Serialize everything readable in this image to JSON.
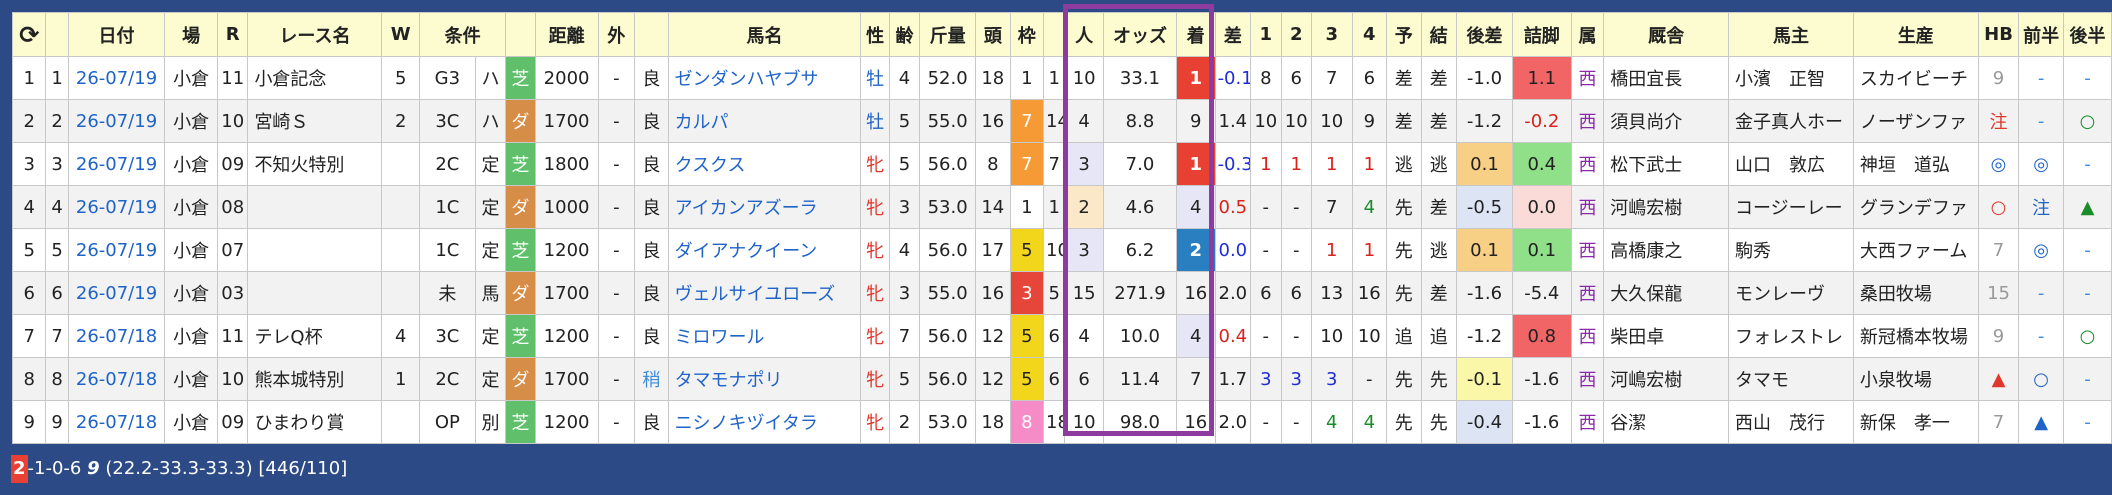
{
  "header": {
    "refresh_icon": "⟳",
    "date": "日付",
    "venue": "場",
    "race_no": "R",
    "race_name": "レース名",
    "w": "W",
    "condition": "条件",
    "distance": "距離",
    "outside": "外",
    "horse": "馬名",
    "sex": "性",
    "age": "齢",
    "weight": "斤量",
    "heads": "頭",
    "waku": "枠",
    "popularity": "人",
    "odds": "オッズ",
    "finish": "着",
    "margin": "差",
    "c1": "1",
    "c2": "2",
    "c3": "3",
    "c4": "4",
    "pred": "予",
    "result": "結",
    "late3f": "後差",
    "closing": "詰脚",
    "belong": "属",
    "stable": "厩舎",
    "owner": "馬主",
    "breeder": "生産",
    "hb": "HB",
    "first_half": "前半",
    "second_half": "後半"
  },
  "rows": [
    {
      "idx": "1",
      "no": "1",
      "date": "26-07/19",
      "venue": "小倉",
      "r": "11",
      "race": "小倉記念",
      "w": "5",
      "cls": "G3",
      "mark": "ハ",
      "surf": "芝",
      "surf_type": "turf",
      "dist": "2000",
      "out": "-",
      "cond": "良",
      "horse": "ゼンダンハヤブサ",
      "sex": "牡",
      "sex_type": "m",
      "age": "4",
      "kg": "52.0",
      "heads": "18",
      "waku": "1",
      "umaban": "1",
      "pop": "10",
      "odds": "33.1",
      "fin": "1",
      "margin": "-0.1",
      "c1": "8",
      "c2": "6",
      "c3": "7",
      "c4": "6",
      "pred": "差",
      "res": "差",
      "late": "-1.0",
      "close": "1.1",
      "belong": "西",
      "stable": "橋田宜長",
      "owner": "小濱　正智",
      "breeder": "スカイビーチ",
      "hb": "9",
      "fh": "-",
      "sh": "-"
    },
    {
      "idx": "2",
      "no": "2",
      "date": "26-07/19",
      "venue": "小倉",
      "r": "10",
      "race": "宮崎Ｓ",
      "w": "2",
      "cls": "3C",
      "mark": "ハ",
      "surf": "ダ",
      "surf_type": "dirt",
      "dist": "1700",
      "out": "-",
      "cond": "良",
      "horse": "カルパ",
      "sex": "牡",
      "sex_type": "m",
      "age": "5",
      "kg": "55.0",
      "heads": "16",
      "waku": "7",
      "umaban": "14",
      "pop": "4",
      "odds": "8.8",
      "fin": "9",
      "margin": "1.4",
      "c1": "10",
      "c2": "10",
      "c3": "10",
      "c4": "9",
      "pred": "差",
      "res": "差",
      "late": "-1.2",
      "close": "-0.2",
      "belong": "西",
      "stable": "須貝尚介",
      "owner": "金子真人ホー",
      "breeder": "ノーザンファ",
      "hb": "注",
      "fh": "-",
      "sh": "○"
    },
    {
      "idx": "3",
      "no": "3",
      "date": "26-07/19",
      "venue": "小倉",
      "r": "09",
      "race": "不知火特別",
      "w": "",
      "cls": "2C",
      "mark": "定",
      "surf": "芝",
      "surf_type": "turf",
      "dist": "1800",
      "out": "-",
      "cond": "良",
      "horse": "クスクス",
      "sex": "牝",
      "sex_type": "f",
      "age": "5",
      "kg": "56.0",
      "heads": "8",
      "waku": "7",
      "umaban": "7",
      "pop": "3",
      "odds": "7.0",
      "fin": "1",
      "margin": "-0.3",
      "c1": "1",
      "c2": "1",
      "c3": "1",
      "c4": "1",
      "pred": "逃",
      "res": "逃",
      "late": "0.1",
      "close": "0.4",
      "belong": "西",
      "stable": "松下武士",
      "owner": "山口　敦広",
      "breeder": "神垣　道弘",
      "hb": "◎",
      "fh": "◎",
      "sh": "-"
    },
    {
      "idx": "4",
      "no": "4",
      "date": "26-07/19",
      "venue": "小倉",
      "r": "08",
      "race": "",
      "w": "",
      "cls": "1C",
      "mark": "定",
      "surf": "ダ",
      "surf_type": "dirt",
      "dist": "1000",
      "out": "-",
      "cond": "良",
      "horse": "アイカンアズーラ",
      "sex": "牝",
      "sex_type": "f",
      "age": "3",
      "kg": "53.0",
      "heads": "14",
      "waku": "1",
      "umaban": "1",
      "pop": "2",
      "odds": "4.6",
      "fin": "4",
      "margin": "0.5",
      "c1": "-",
      "c2": "-",
      "c3": "7",
      "c4": "4",
      "pred": "先",
      "res": "差",
      "late": "-0.5",
      "close": "0.0",
      "belong": "西",
      "stable": "河嶋宏樹",
      "owner": "コージーレー",
      "breeder": "グランデファ",
      "hb": "○",
      "fh": "注",
      "sh": "▲"
    },
    {
      "idx": "5",
      "no": "5",
      "date": "26-07/19",
      "venue": "小倉",
      "r": "07",
      "race": "",
      "w": "",
      "cls": "1C",
      "mark": "定",
      "surf": "芝",
      "surf_type": "turf",
      "dist": "1200",
      "out": "-",
      "cond": "良",
      "horse": "ダイアナクイーン",
      "sex": "牝",
      "sex_type": "f",
      "age": "4",
      "kg": "56.0",
      "heads": "17",
      "waku": "5",
      "umaban": "10",
      "pop": "3",
      "odds": "6.2",
      "fin": "2",
      "margin": "0.0",
      "c1": "-",
      "c2": "-",
      "c3": "1",
      "c4": "1",
      "pred": "先",
      "res": "逃",
      "late": "0.1",
      "close": "0.1",
      "belong": "西",
      "stable": "高橋康之",
      "owner": "駒秀",
      "breeder": "大西ファーム",
      "hb": "7",
      "fh": "◎",
      "sh": "-"
    },
    {
      "idx": "6",
      "no": "6",
      "date": "26-07/19",
      "venue": "小倉",
      "r": "03",
      "race": "",
      "w": "",
      "cls": "未",
      "mark": "馬",
      "surf": "ダ",
      "surf_type": "dirt",
      "dist": "1700",
      "out": "-",
      "cond": "良",
      "horse": "ヴェルサイユローズ",
      "sex": "牝",
      "sex_type": "f",
      "age": "3",
      "kg": "55.0",
      "heads": "16",
      "waku": "3",
      "umaban": "5",
      "pop": "15",
      "odds": "271.9",
      "fin": "16",
      "margin": "2.0",
      "c1": "6",
      "c2": "6",
      "c3": "13",
      "c4": "16",
      "pred": "先",
      "res": "差",
      "late": "-1.6",
      "close": "-5.4",
      "belong": "西",
      "stable": "大久保龍",
      "owner": "モンレーヴ",
      "breeder": "桑田牧場",
      "hb": "15",
      "fh": "-",
      "sh": "-"
    },
    {
      "idx": "7",
      "no": "7",
      "date": "26-07/18",
      "venue": "小倉",
      "r": "11",
      "race": "テレQ杯",
      "w": "4",
      "cls": "3C",
      "mark": "定",
      "surf": "芝",
      "surf_type": "turf",
      "dist": "1200",
      "out": "-",
      "cond": "良",
      "horse": "ミロワール",
      "sex": "牝",
      "sex_type": "f",
      "age": "7",
      "kg": "56.0",
      "heads": "12",
      "waku": "5",
      "umaban": "6",
      "pop": "4",
      "odds": "10.0",
      "fin": "4",
      "margin": "0.4",
      "c1": "-",
      "c2": "-",
      "c3": "10",
      "c4": "10",
      "pred": "追",
      "res": "追",
      "late": "-1.2",
      "close": "0.8",
      "belong": "西",
      "stable": "柴田卓",
      "owner": "フォレストレ",
      "breeder": "新冠橋本牧場",
      "hb": "9",
      "fh": "-",
      "sh": "○"
    },
    {
      "idx": "8",
      "no": "8",
      "date": "26-07/18",
      "venue": "小倉",
      "r": "10",
      "race": "熊本城特別",
      "w": "1",
      "cls": "2C",
      "mark": "定",
      "surf": "ダ",
      "surf_type": "dirt",
      "dist": "1700",
      "out": "-",
      "cond": "稍",
      "horse": "タマモナポリ",
      "sex": "牝",
      "sex_type": "f",
      "age": "5",
      "kg": "56.0",
      "heads": "12",
      "waku": "5",
      "umaban": "6",
      "pop": "6",
      "odds": "11.4",
      "fin": "7",
      "margin": "1.7",
      "c1": "3",
      "c2": "3",
      "c3": "3",
      "c4": "-",
      "pred": "先",
      "res": "先",
      "late": "-0.1",
      "close": "-1.6",
      "belong": "西",
      "stable": "河嶋宏樹",
      "owner": "タマモ",
      "breeder": "小泉牧場",
      "hb": "▲",
      "fh": "○",
      "sh": "-"
    },
    {
      "idx": "9",
      "no": "9",
      "date": "26-07/18",
      "venue": "小倉",
      "r": "09",
      "race": "ひまわり賞",
      "w": "",
      "cls": "OP",
      "mark": "別",
      "surf": "芝",
      "surf_type": "turf",
      "dist": "1200",
      "out": "-",
      "cond": "良",
      "horse": "ニシノキヅイタラ",
      "sex": "牝",
      "sex_type": "f",
      "age": "2",
      "kg": "53.0",
      "heads": "18",
      "waku": "8",
      "umaban": "18",
      "pop": "10",
      "odds": "98.0",
      "fin": "16",
      "margin": "2.0",
      "c1": "-",
      "c2": "-",
      "c3": "4",
      "c4": "4",
      "pred": "先",
      "res": "先",
      "late": "-0.4",
      "close": "-1.6",
      "belong": "西",
      "stable": "谷潔",
      "owner": "西山　茂行",
      "breeder": "新保　孝一",
      "hb": "7",
      "fh": "▲",
      "sh": "-"
    }
  ],
  "footer": {
    "rank_badge": "2",
    "record": "-1-0-6",
    "total": "9",
    "splits": "(22.2-33.3-33.3)",
    "ratio": "[446/110]"
  },
  "colors": {
    "background": "#2c4a86",
    "header_bg": "#fdfbd0",
    "highlight_border": "#8e3ba0",
    "win": "#e84133",
    "second": "#2a7fc0"
  }
}
